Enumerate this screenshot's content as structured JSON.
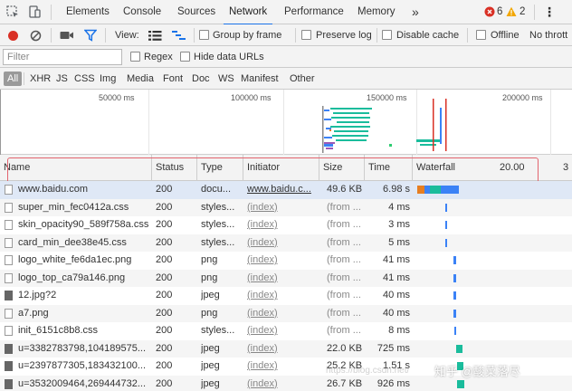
{
  "tabbar": {
    "tabs": [
      {
        "label": "Elements"
      },
      {
        "label": "Console"
      },
      {
        "label": "Sources"
      },
      {
        "label": "Network"
      },
      {
        "label": "Performance"
      },
      {
        "label": "Memory"
      }
    ],
    "more": "»",
    "errors": "6",
    "warnings": "2",
    "menu": "⋮"
  },
  "toolbar": {
    "view_label": "View:",
    "group_by_frame": "Group by frame",
    "preserve_log": "Preserve log",
    "disable_cache": "Disable cache",
    "offline": "Offline",
    "throttle": "No thrott"
  },
  "filterbar": {
    "placeholder": "Filter",
    "regex": "Regex",
    "hide_data_urls": "Hide data URLs"
  },
  "typebar": {
    "types": [
      "All",
      "XHR",
      "JS",
      "CSS",
      "Img",
      "Media",
      "Font",
      "Doc",
      "WS",
      "Manifest",
      "Other"
    ]
  },
  "overview": {
    "ticks": [
      "50000 ms",
      "100000 ms",
      "150000 ms",
      "200000 ms"
    ]
  },
  "columns": {
    "name": "Name",
    "status": "Status",
    "type": "Type",
    "initiator": "Initiator",
    "size": "Size",
    "time": "Time",
    "waterfall": "Waterfall",
    "waterfall_tick": "20.00",
    "waterfall_tick2": "3"
  },
  "rows": [
    {
      "name": "www.baidu.com",
      "status": "200",
      "type": "docu...",
      "initiator": "www.baidu.c...",
      "size": "49.6 KB",
      "time": "6.98 s",
      "icon": "document"
    },
    {
      "name": "super_min_fec0412a.css",
      "status": "200",
      "type": "styles...",
      "initiator": "(index)",
      "size": "(from ...",
      "time": "4 ms",
      "icon": "document"
    },
    {
      "name": "skin_opacity90_589f758a.css",
      "status": "200",
      "type": "styles...",
      "initiator": "(index)",
      "size": "(from ...",
      "time": "3 ms",
      "icon": "document"
    },
    {
      "name": "card_min_dee38e45.css",
      "status": "200",
      "type": "styles...",
      "initiator": "(index)",
      "size": "(from ...",
      "time": "5 ms",
      "icon": "document"
    },
    {
      "name": "logo_white_fe6da1ec.png",
      "status": "200",
      "type": "png",
      "initiator": "(index)",
      "size": "(from ...",
      "time": "41 ms",
      "icon": "document"
    },
    {
      "name": "logo_top_ca79a146.png",
      "status": "200",
      "type": "png",
      "initiator": "(index)",
      "size": "(from ...",
      "time": "41 ms",
      "icon": "document"
    },
    {
      "name": "12.jpg?2",
      "status": "200",
      "type": "jpeg",
      "initiator": "(index)",
      "size": "(from ...",
      "time": "40 ms",
      "icon": "image"
    },
    {
      "name": "a7.png",
      "status": "200",
      "type": "png",
      "initiator": "(index)",
      "size": "(from ...",
      "time": "40 ms",
      "icon": "document"
    },
    {
      "name": "init_6151c8b8.css",
      "status": "200",
      "type": "styles...",
      "initiator": "(index)",
      "size": "(from ...",
      "time": "8 ms",
      "icon": "document"
    },
    {
      "name": "u=3382783798,104189575...",
      "status": "200",
      "type": "jpeg",
      "initiator": "(index)",
      "size": "22.0 KB",
      "time": "725 ms",
      "icon": "image"
    },
    {
      "name": "u=2397877305,183432100...",
      "status": "200",
      "type": "jpeg",
      "initiator": "(index)",
      "size": "25.2 KB",
      "time": "1.51 s",
      "icon": "image"
    },
    {
      "name": "u=3532009464,269444732...",
      "status": "200",
      "type": "jpeg",
      "initiator": "(index)",
      "size": "26.7 KB",
      "time": "926 ms",
      "icon": "image"
    }
  ],
  "watermark": "知乎 @酸菜落尽",
  "colors": {
    "accent": "#1a73e8",
    "record": "#d93025",
    "highlight_box": "#e2646e",
    "waterfall_blue": "#3b82f6",
    "waterfall_teal": "#1abc9c"
  }
}
